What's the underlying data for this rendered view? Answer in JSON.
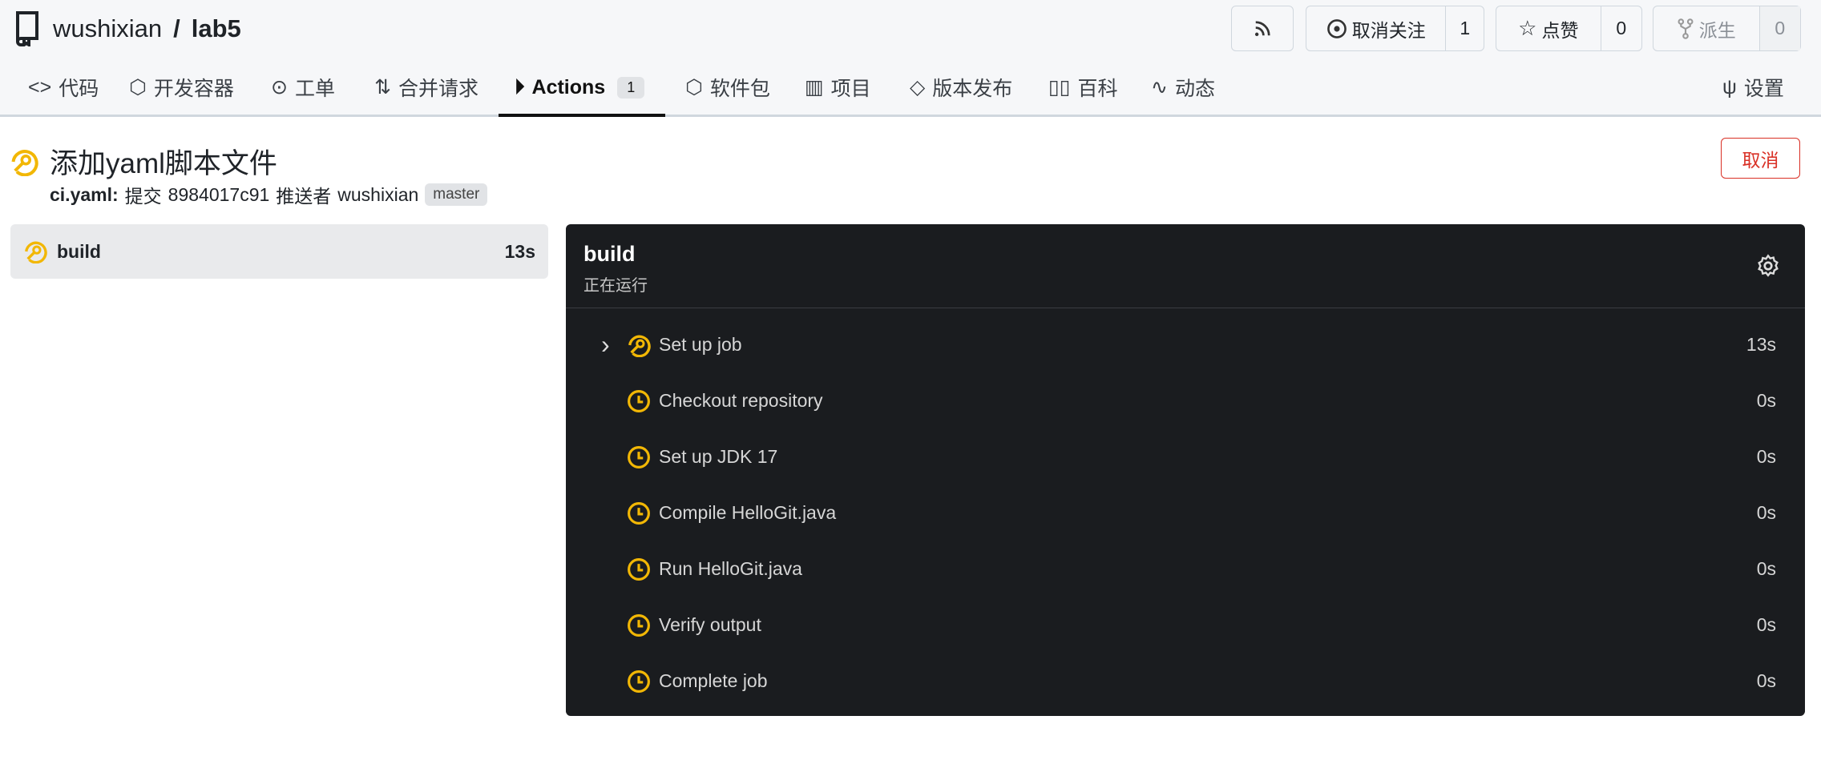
{
  "repo": {
    "owner": "wushixian",
    "sep": "/",
    "name": "lab5"
  },
  "header_buttons": {
    "watch_label": "取消关注",
    "watch_count": "1",
    "star_label": "点赞",
    "star_count": "0",
    "fork_label": "派生",
    "fork_count": "0"
  },
  "nav": [
    {
      "label": "代码"
    },
    {
      "label": "开发容器"
    },
    {
      "label": "工单"
    },
    {
      "label": "合并请求"
    },
    {
      "label": "Actions",
      "badge": "1"
    },
    {
      "label": "软件包"
    },
    {
      "label": "项目"
    },
    {
      "label": "版本发布"
    },
    {
      "label": "百科"
    },
    {
      "label": "动态"
    },
    {
      "label": "设置"
    }
  ],
  "run": {
    "title": "添加yaml脚本文件",
    "workflow": "ci.yaml:",
    "commit_label": "提交",
    "commit": "8984017c91",
    "pusher_label": "推送者",
    "pusher": "wushixian",
    "branch": "master",
    "cancel_label": "取消"
  },
  "jobs": [
    {
      "name": "build",
      "duration": "13s"
    }
  ],
  "panel": {
    "title": "build",
    "status": "正在运行",
    "steps": [
      {
        "name": "Set up job",
        "duration": "13s"
      },
      {
        "name": "Checkout repository",
        "duration": "0s"
      },
      {
        "name": "Set up JDK 17",
        "duration": "0s"
      },
      {
        "name": "Compile HelloGit.java",
        "duration": "0s"
      },
      {
        "name": "Run HelloGit.java",
        "duration": "0s"
      },
      {
        "name": "Verify output",
        "duration": "0s"
      },
      {
        "name": "Complete job",
        "duration": "0s"
      }
    ]
  },
  "colors": {
    "running": "#f2b705",
    "danger": "#d93025",
    "panel_bg": "#1a1c1f"
  }
}
